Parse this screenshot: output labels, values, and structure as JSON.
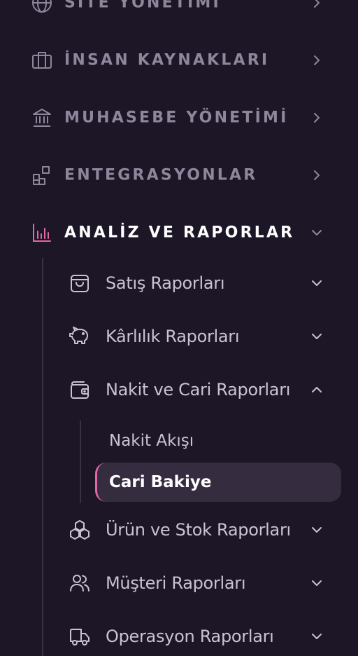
{
  "colors": {
    "background": "#1d1626",
    "muted_text": "#8f869c",
    "sub_text": "#c9c2d3",
    "active_text": "#ffffff",
    "accent_pink": "#e268a8",
    "active_bg": "#352c40"
  },
  "nav": {
    "top_items": [
      {
        "label": "SİTE YÖNETİMİ",
        "icon": "globe-icon",
        "state": "collapsed"
      },
      {
        "label": "İNSAN KAYNAKLARI",
        "icon": "briefcase-icon",
        "state": "collapsed"
      },
      {
        "label": "MUHASEBE YÖNETİMİ",
        "icon": "bank-icon",
        "state": "collapsed"
      },
      {
        "label": "ENTEGRASYONLAR",
        "icon": "widgets-icon",
        "state": "collapsed"
      },
      {
        "label": "ANALİZ VE RAPORLAR",
        "icon": "bar-chart-icon",
        "state": "expanded"
      }
    ],
    "sub_items": [
      {
        "label": "Satış Raporları",
        "icon": "shopping-bag-icon",
        "state": "collapsed"
      },
      {
        "label": "Kârlılık Raporları",
        "icon": "piggy-bank-icon",
        "state": "collapsed"
      },
      {
        "label": "Nakit ve Cari Raporları",
        "icon": "wallet-icon",
        "state": "expanded"
      },
      {
        "label": "Ürün ve Stok Raporları",
        "icon": "boxes-icon",
        "state": "collapsed"
      },
      {
        "label": "Müşteri Raporları",
        "icon": "users-icon",
        "state": "collapsed"
      },
      {
        "label": "Operasyon Raporları",
        "icon": "truck-icon",
        "state": "collapsed"
      }
    ],
    "leaf_items": [
      {
        "label": "Nakit Akışı",
        "active": false
      },
      {
        "label": "Cari Bakiye",
        "active": true
      }
    ]
  }
}
